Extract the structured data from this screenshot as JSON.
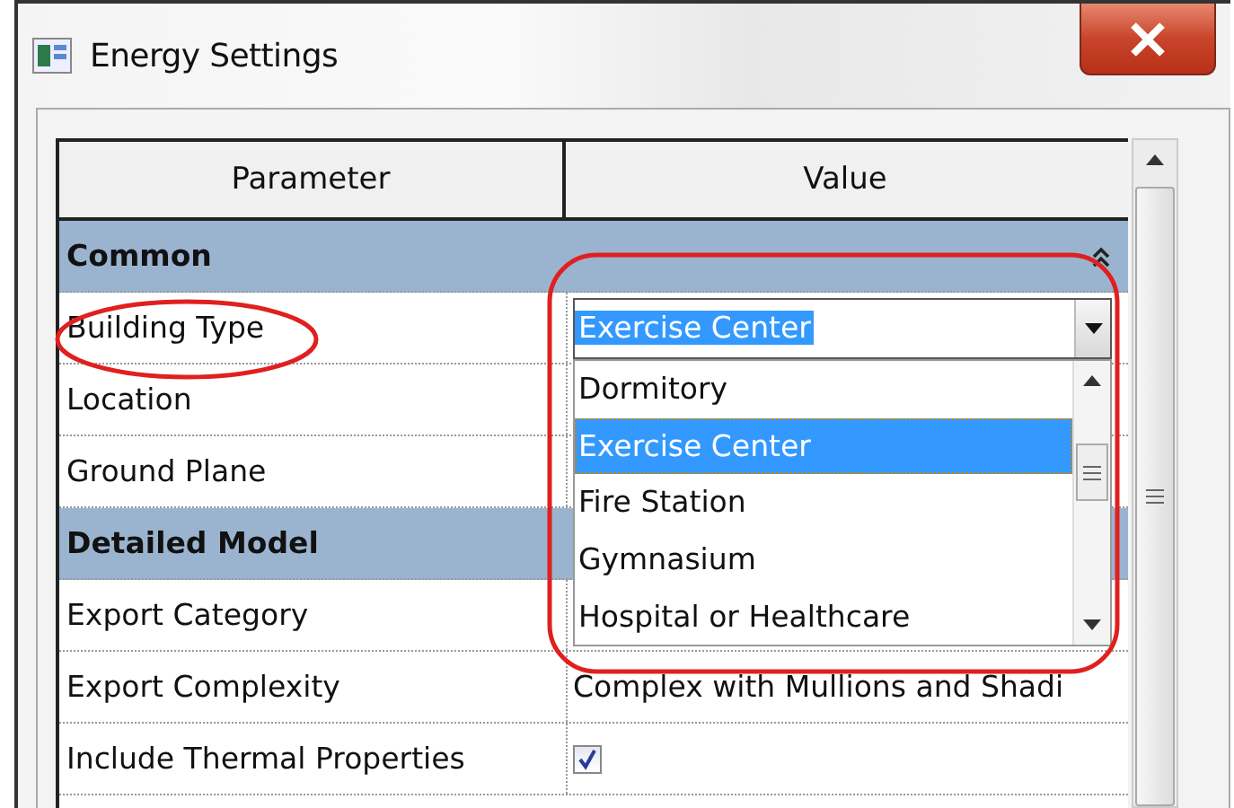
{
  "window": {
    "title": "Energy Settings"
  },
  "table": {
    "columns": [
      "Parameter",
      "Value"
    ],
    "rows": [
      {
        "kind": "category",
        "label": "Common",
        "expanded": true
      },
      {
        "kind": "dropdown",
        "label": "Building Type",
        "value": "Exercise Center",
        "open": true,
        "options": [
          {
            "label": "Dormitory",
            "selected": false
          },
          {
            "label": "Exercise Center",
            "selected": true
          },
          {
            "label": "Fire Station",
            "selected": false
          },
          {
            "label": "Gymnasium",
            "selected": false
          },
          {
            "label": "Hospital or Healthcare",
            "selected": false
          }
        ]
      },
      {
        "kind": "text",
        "label": "Location"
      },
      {
        "kind": "text",
        "label": "Ground Plane"
      },
      {
        "kind": "category",
        "label": "Detailed Model"
      },
      {
        "kind": "text",
        "label": "Export Category"
      },
      {
        "kind": "text",
        "label": "Export Complexity",
        "value": "Complex with Mullions and Shadi"
      },
      {
        "kind": "checkbox",
        "label": "Include Thermal Properties",
        "checked": true
      }
    ]
  }
}
